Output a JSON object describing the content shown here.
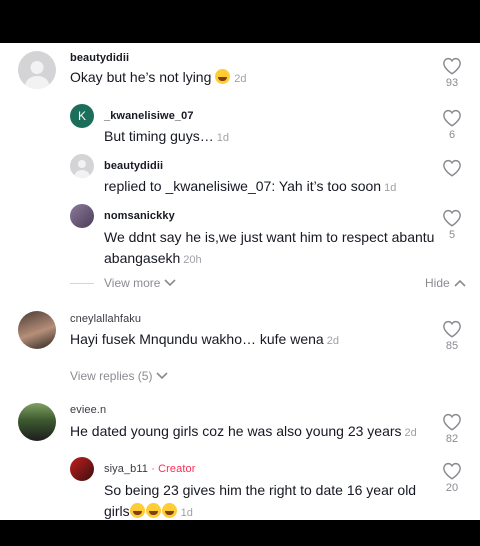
{
  "comments": [
    {
      "user": "beautydidii",
      "text": "Okay but he’s not lying",
      "time": "2d",
      "likes": "93"
    },
    {
      "user": "_kwanelisiwe_07",
      "avatar_letter": "K",
      "text": "But timing guys…",
      "time": "1d",
      "likes": "6"
    },
    {
      "user": "beautydidii",
      "text": "replied to _kwanelisiwe_07: Yah it’s too soon",
      "time": "1d",
      "likes": ""
    },
    {
      "user": "nomsanickky",
      "text_line1": "We ddnt say he is,we just want him to respect abantu",
      "text_line2": "abangasekh",
      "time": "20h",
      "likes": "5"
    },
    {
      "user": "cneylallahfaku",
      "text": "Hayi fusek Mnqundu wakho… kufe wena",
      "time": "2d",
      "likes": "85"
    },
    {
      "user": "eviee.n",
      "text": "He dated young girls coz he was also young 23 years",
      "time": "2d",
      "likes": "82"
    },
    {
      "user": "siya_b11",
      "creator_label": "· Creator",
      "text_line1": "So being 23 gives him the right to date 16 year old",
      "text_line2": "girls",
      "time": "1d",
      "likes": "20"
    }
  ],
  "controls": {
    "view_more": "View more",
    "hide": "Hide",
    "view_replies": "View replies (5)"
  },
  "colors": {
    "creator": "#fe2c55",
    "k_avatar": "#1b6f5a"
  },
  "icons": [
    "heart-icon",
    "chevron-down-icon",
    "chevron-up-icon",
    "avatar-icon",
    "emoji-icon"
  ]
}
